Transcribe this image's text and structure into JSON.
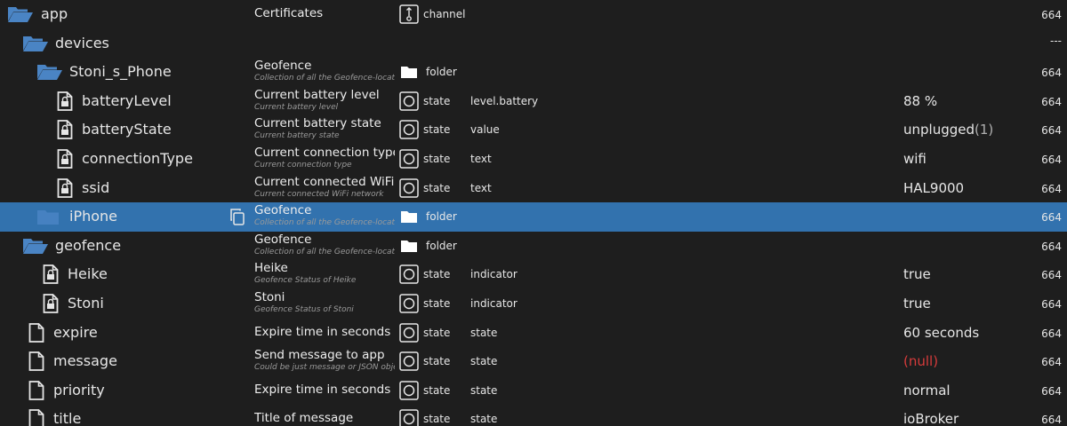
{
  "rows": [
    {
      "name": "app",
      "icon": "folder-open-icon",
      "title": "Certificates",
      "desc": "",
      "type": "channel",
      "role": "",
      "value": "",
      "value_suffix": "",
      "right": "664"
    },
    {
      "name": "devices",
      "icon": "folder-open-icon",
      "title": "",
      "desc": "",
      "type": "",
      "role": "",
      "value": "",
      "value_suffix": "",
      "right": "---"
    },
    {
      "name": "Stoni_s_Phone",
      "icon": "folder-open-icon",
      "title": "Geofence",
      "desc": "Collection of all the Geofence-locatio",
      "type": "folder",
      "role": "",
      "value": "",
      "value_suffix": "",
      "right": "664"
    },
    {
      "name": "batteryLevel",
      "icon": "lock-file-icon",
      "title": "Current battery level",
      "desc": "Current battery level",
      "type": "state",
      "role": "level.battery",
      "value": "88 %",
      "value_suffix": "",
      "right": "664"
    },
    {
      "name": "batteryState",
      "icon": "lock-file-icon",
      "title": "Current battery state",
      "desc": "Current battery state",
      "type": "state",
      "role": "value",
      "value": "unplugged",
      "value_suffix": "(1)",
      "right": "664"
    },
    {
      "name": "connectionType",
      "icon": "lock-file-icon",
      "title": "Current connection type",
      "desc": "Current connection type",
      "type": "state",
      "role": "text",
      "value": "wifi",
      "value_suffix": "",
      "right": "664"
    },
    {
      "name": "ssid",
      "icon": "lock-file-icon",
      "title": "Current connected WiFi",
      "desc": "Current connected WiFi network",
      "type": "state",
      "role": "text",
      "value": "HAL9000",
      "value_suffix": "",
      "right": "664"
    },
    {
      "name": "iPhone",
      "icon": "folder-closed-icon",
      "title": "Geofence",
      "desc": "Collection of all the Geofence-locatio",
      "type": "folder",
      "role": "",
      "value": "",
      "value_suffix": "",
      "right": "664",
      "selected": true
    },
    {
      "name": "geofence",
      "icon": "folder-open-icon",
      "title": "Geofence",
      "desc": "Collection of all the Geofence-locatio",
      "type": "folder",
      "role": "",
      "value": "",
      "value_suffix": "",
      "right": "664"
    },
    {
      "name": "Heike",
      "icon": "lock-file-icon",
      "title": "Heike",
      "desc": "Geofence Status of Heike",
      "type": "state",
      "role": "indicator",
      "value": "true",
      "value_suffix": "",
      "right": "664"
    },
    {
      "name": "Stoni",
      "icon": "lock-file-icon",
      "title": "Stoni",
      "desc": "Geofence Status of Stoni",
      "type": "state",
      "role": "indicator",
      "value": "true",
      "value_suffix": "",
      "right": "664"
    },
    {
      "name": "expire",
      "icon": "file-icon",
      "title": "Expire time in seconds",
      "desc": "",
      "type": "state",
      "role": "state",
      "value": "60 seconds",
      "value_suffix": "",
      "right": "664"
    },
    {
      "name": "message",
      "icon": "file-icon",
      "title": "Send message to app",
      "desc": "Could be just message or JSON objec",
      "type": "state",
      "role": "state",
      "value": "(null)",
      "value_suffix": "",
      "right": "664",
      "value_null": true
    },
    {
      "name": "priority",
      "icon": "file-icon",
      "title": "Expire time in seconds",
      "desc": "",
      "type": "state",
      "role": "state",
      "value": "normal",
      "value_suffix": "",
      "right": "664"
    },
    {
      "name": "title",
      "icon": "file-icon",
      "title": "Title of message",
      "desc": "",
      "type": "state",
      "role": "state",
      "value": "ioBroker",
      "value_suffix": "",
      "right": "664"
    }
  ],
  "colors": {
    "background": "#1e1e1e",
    "selected_row": "#3272ae",
    "folder_icon": "#4a84c4",
    "null_value": "#d63b3b"
  }
}
